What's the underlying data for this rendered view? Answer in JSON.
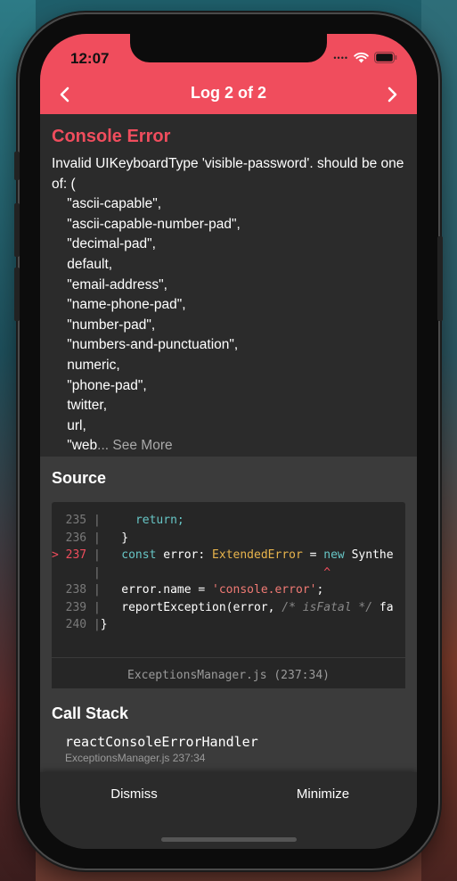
{
  "status_bar": {
    "time": "12:07"
  },
  "nav": {
    "title": "Log 2 of 2"
  },
  "error": {
    "title": "Console Error",
    "message": "Invalid UIKeyboardType 'visible-password'. should be one of: (\n    \"ascii-capable\",\n    \"ascii-capable-number-pad\",\n    \"decimal-pad\",\n    default,\n    \"email-address\",\n    \"name-phone-pad\",\n    \"number-pad\",\n    \"numbers-and-punctuation\",\n    numeric,\n    \"phone-pad\",\n    twitter,\n    url,\n    \"web",
    "see_more": "... See More"
  },
  "source": {
    "title": "Source",
    "lines": [
      {
        "num": "  235",
        "text": "    return;"
      },
      {
        "num": "  236",
        "text": "  }"
      },
      {
        "num": "> 237",
        "text": "  const error: ExtendedError = new Synthe"
      },
      {
        "num": "     ",
        "text": "                               ^"
      },
      {
        "num": "  238",
        "text": "  error.name = 'console.error';"
      },
      {
        "num": "  239",
        "text": "  reportException(error, /* isFatal */ fa"
      },
      {
        "num": "  240",
        "text": "}"
      }
    ],
    "file": "ExceptionsManager.js (237:34)"
  },
  "call_stack": {
    "title": "Call Stack",
    "frames": [
      {
        "fn": "reactConsoleErrorHandler",
        "loc": "ExceptionsManager.js 237:34"
      }
    ]
  },
  "footer": {
    "dismiss_label": "Dismiss",
    "minimize_label": "Minimize"
  },
  "colors": {
    "accent": "#f04d5d",
    "background": "#2b2b2b",
    "section_bg": "#3b3b3b"
  }
}
